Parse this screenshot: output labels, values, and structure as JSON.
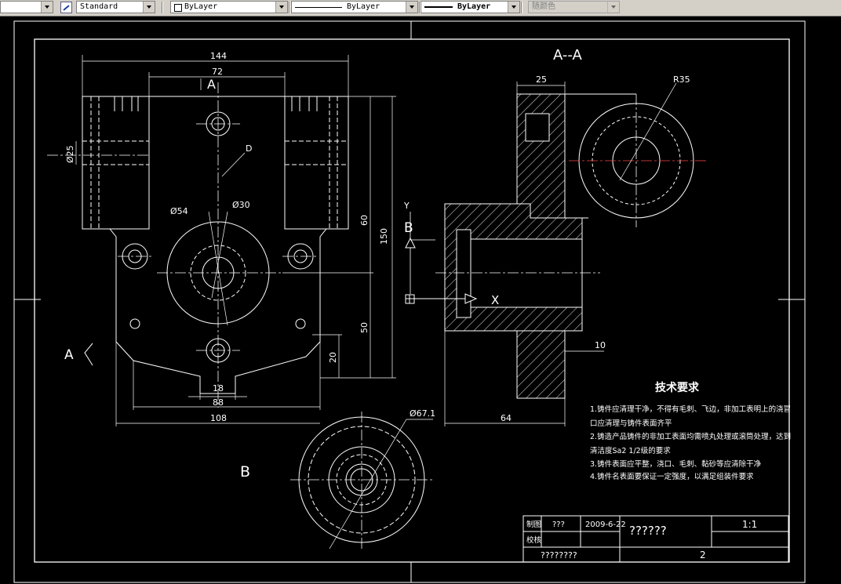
{
  "toolbar": {
    "text_style": "Standard",
    "layer": "ByLayer",
    "linetype": "ByLayer",
    "lineweight": "ByLayer",
    "plot_style": "随颜色"
  },
  "drawing": {
    "section_label": "A--A",
    "view_a_label": "A",
    "view_b_label": "B",
    "view_marker_a": "A",
    "view_marker_b": "B",
    "axis_x": "X",
    "axis_y": "Y",
    "dims": {
      "d144": "144",
      "d72": "72",
      "dia25": "Ø25",
      "label_d": "D",
      "dia54": "Ø54",
      "dia30": "Ø30",
      "d60": "60",
      "d150": "150",
      "d50": "50",
      "d20": "20",
      "d18": "18",
      "d88": "88",
      "d108": "108",
      "d25": "25",
      "r35": "R35",
      "d10": "10",
      "d64": "64",
      "dia67": "Ø67.1"
    },
    "tech_title": "技术要求",
    "tech_notes": [
      "1.铸件应清理干净，不得有毛刺、飞边，非加工表明上的浇冒",
      "口应清理与铸件表面齐平",
      "2.铸造产品铸件的非加工表面均需喷丸处理或滚筒处理，达到",
      "清洁度Sa2 1/2级的要求",
      "3.铸件表面应平整，浇口、毛刺、黏砂等应清除干净",
      "4.铸件名表面要保证一定强度，以满足组装件要求"
    ],
    "title_block": {
      "drawn_label": "制图",
      "drawn_by": "???",
      "date": "2009-6-22",
      "part_name": "??????",
      "scale": "1:1",
      "checked_label": "校核",
      "school": "????????",
      "sheet": "2"
    }
  }
}
